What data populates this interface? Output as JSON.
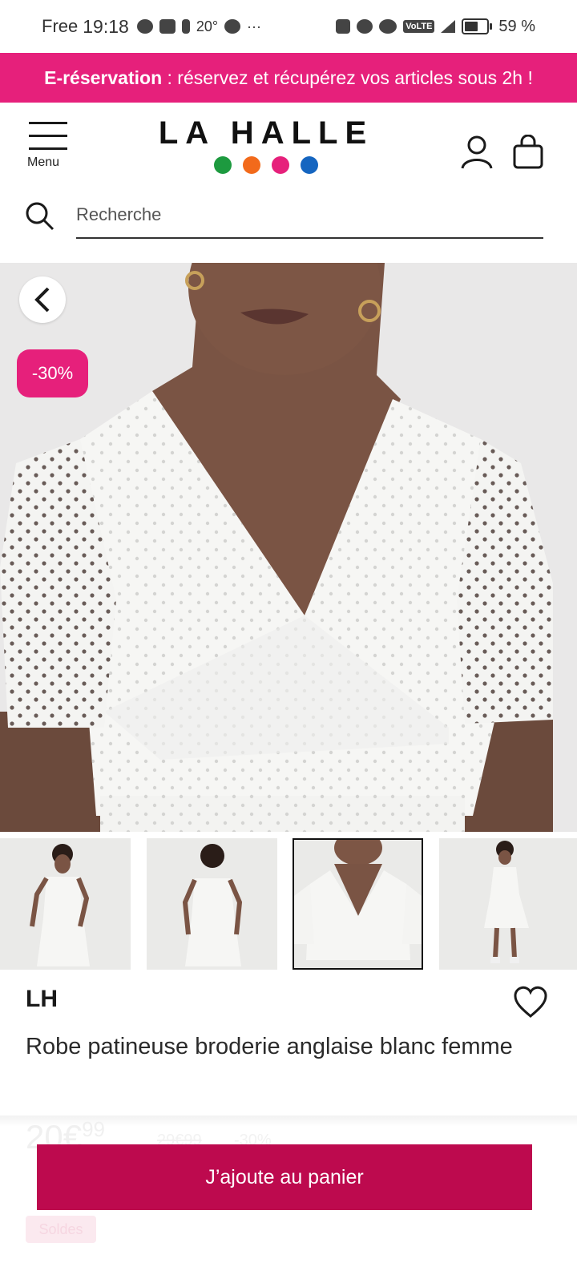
{
  "status_bar": {
    "carrier": "Free",
    "time": "19:18",
    "temperature": "20°",
    "more": "···",
    "volte": "VoLTE",
    "battery": "59 %"
  },
  "promo_banner": {
    "bold": "E-réservation",
    "text": " : réservez et récupérez vos articles sous 2h !"
  },
  "header": {
    "menu_label": "Menu",
    "logo_text": "LA HALLE",
    "logo_dot_colors": [
      "#1d9a3f",
      "#f26a1b",
      "#e6207b",
      "#1565c0"
    ],
    "icons": [
      "hamburger-icon",
      "user-icon",
      "shopping-bag-icon"
    ]
  },
  "search": {
    "placeholder": "Recherche"
  },
  "gallery": {
    "discount_badge": "-30%",
    "selected_thumbnail": 3,
    "thumbnail_count": 4
  },
  "product": {
    "brand": "LH",
    "title": "Robe patineuse broderie anglaise blanc femme",
    "price_main": "20€",
    "price_cents": "99",
    "old_price": "29€99",
    "discount_pct": "-30%",
    "sale_tag": "Soldes"
  },
  "cta": {
    "add_to_cart": "J’ajoute au panier"
  },
  "colors": {
    "brand_pink": "#e6207b",
    "cta_red": "#bd0a4e"
  }
}
